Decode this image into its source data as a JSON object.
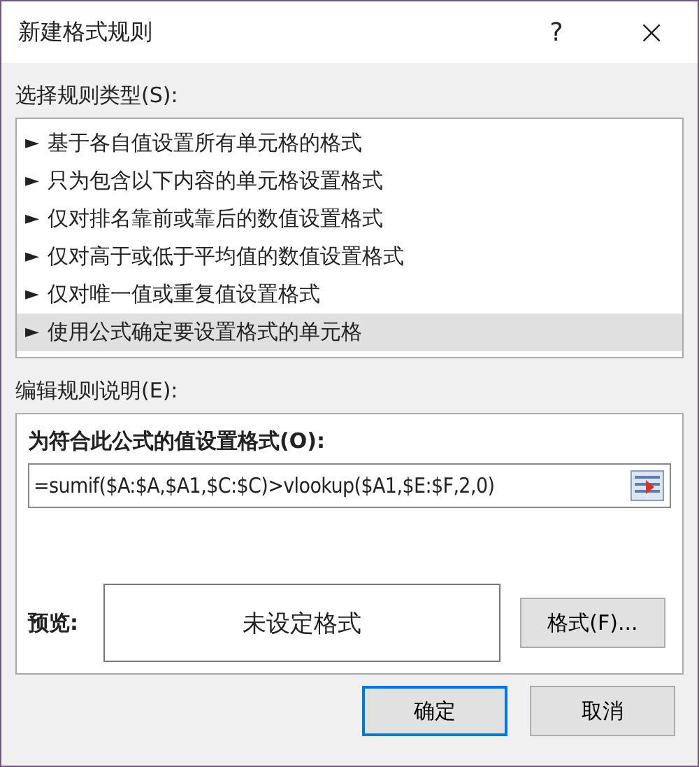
{
  "window": {
    "title": "新建格式规则",
    "help": "?",
    "close": "×"
  },
  "rule_type": {
    "label": "选择规则类型(S):",
    "items": [
      {
        "arrow": "►",
        "label": "基于各自值设置所有单元格的格式",
        "selected": false
      },
      {
        "arrow": "►",
        "label": "只为包含以下内容的单元格设置格式",
        "selected": false
      },
      {
        "arrow": "►",
        "label": "仅对排名靠前或靠后的数值设置格式",
        "selected": false
      },
      {
        "arrow": "►",
        "label": "仅对高于或低于平均值的数值设置格式",
        "selected": false
      },
      {
        "arrow": "►",
        "label": "仅对唯一值或重复值设置格式",
        "selected": false
      },
      {
        "arrow": "►",
        "label": "使用公式确定要设置格式的单元格",
        "selected": true
      }
    ]
  },
  "description": {
    "label": "编辑规则说明(E):",
    "formula_label": "为符合此公式的值设置格式(O):",
    "formula": "=sumif($A:$A,$A1,$C:$C)>vlookup($A1,$E:$F,2,0)",
    "preview_label": "预览:",
    "preview_text": "未设定格式",
    "format_button": "格式(F)..."
  },
  "buttons": [
    {
      "label": "确定",
      "default": true
    },
    {
      "label": "取消",
      "default": false
    }
  ]
}
